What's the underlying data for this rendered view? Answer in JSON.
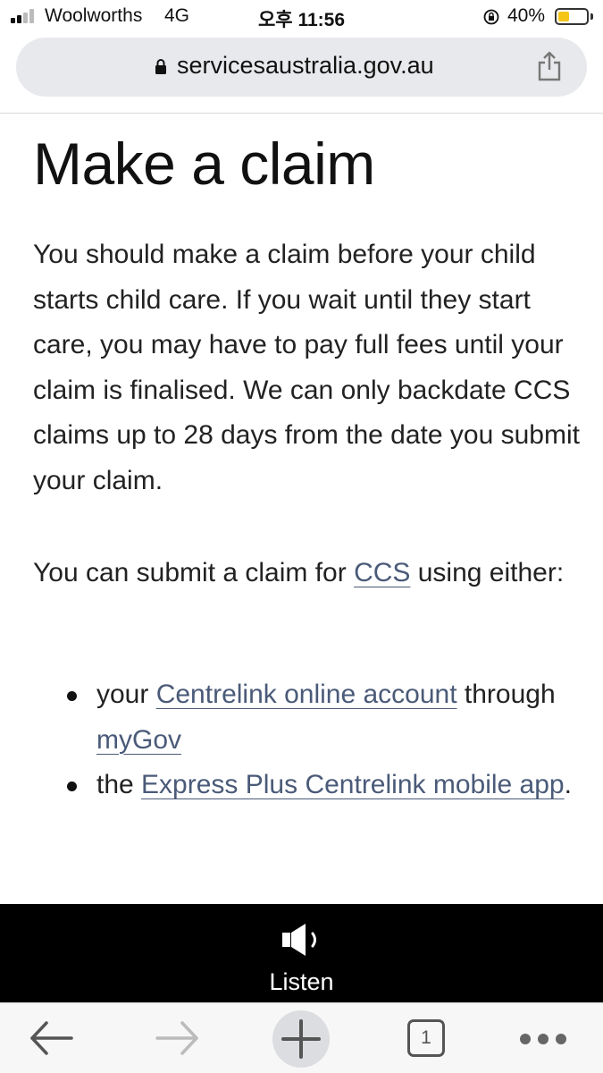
{
  "status_bar": {
    "carrier": "Woolworths",
    "network": "4G",
    "time": "오후 11:56",
    "battery_percent": "40%",
    "battery_level": 0.4,
    "signal_bars": 2
  },
  "browser": {
    "url": "servicesaustralia.gov.au",
    "icons": {
      "lock": "lock-icon",
      "share": "share-icon"
    }
  },
  "page": {
    "title": "Make a claim",
    "paragraph1": "You should make a claim before your child starts child care. If you wait until they start care, you may have to pay full fees until your claim is finalised. We can only backdate CCS claims up to 28 days from the date you submit your claim.",
    "paragraph2": {
      "before": "You can submit a claim for ",
      "link": "CCS",
      "after": " using either:"
    },
    "list": [
      {
        "before": "your ",
        "link1": "Centrelink online account",
        "middle": " through ",
        "link2": "myGov",
        "after": ""
      },
      {
        "before": "the ",
        "link1": "Express Plus Centrelink mobile app",
        "after": "."
      }
    ],
    "link_color": "#4a5a78"
  },
  "listen_bar": {
    "label": "Listen",
    "icon": "speaker-icon"
  },
  "toolbar": {
    "tab_count": "1",
    "icons": [
      "back-arrow-icon",
      "forward-arrow-icon",
      "plus-icon",
      "tabs-icon",
      "more-icon"
    ]
  }
}
